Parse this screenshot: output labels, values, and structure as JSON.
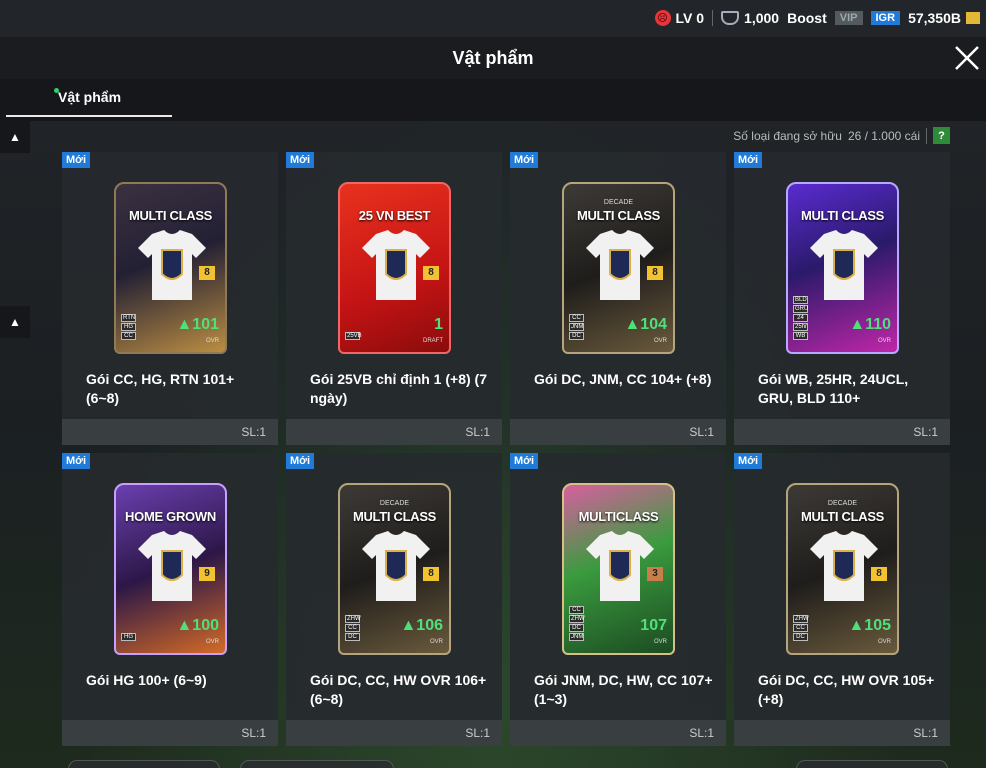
{
  "status": {
    "level": "LV 0",
    "coins": "1,000",
    "boost": "Boost",
    "vip": "VIP",
    "igr": "IGR",
    "bp": "57,350B"
  },
  "header": {
    "title": "Vật phẩm"
  },
  "tabs": [
    {
      "label": "Vật phẩm"
    }
  ],
  "inventory": {
    "count_label": "Số loại đang sở hữu",
    "count_value": "26 / 1.000 cái",
    "help": "?"
  },
  "items": [
    {
      "badge": "Mới",
      "name": "Gói CC, HG, RTN 101+ (6~8)",
      "qty": "SL:1",
      "card": {
        "style": "multi",
        "sub": "",
        "title": "MULTI CLASS",
        "level": "8",
        "ovr": "▲101",
        "ovr_label": "OVR",
        "positions": [
          "RTN",
          "HG",
          "CC"
        ]
      }
    },
    {
      "badge": "Mới",
      "name": "Gói 25VB chỉ định 1 (+8) (7 ngày)",
      "qty": "SL:1",
      "card": {
        "style": "red",
        "sub": "",
        "title": "25 VN BEST",
        "level": "8",
        "ovr": "1",
        "ovr_label": "DRAFT",
        "positions": [
          "25VB"
        ]
      }
    },
    {
      "badge": "Mới",
      "name": "Gói DC, JNM, CC 104+ (+8)",
      "qty": "SL:1",
      "card": {
        "style": "decade",
        "sub": "DECADE",
        "title": "MULTI CLASS",
        "level": "8",
        "ovr": "▲104",
        "ovr_label": "OVR",
        "positions": [
          "CC",
          "JNM",
          "DC"
        ]
      }
    },
    {
      "badge": "Mới",
      "name": "Gói WB, 25HR, 24UCL, GRU, BLD 110+",
      "qty": "SL:1",
      "card": {
        "style": "purple",
        "sub": "",
        "title": "MULTI CLASS",
        "level": "",
        "ovr": "▲110",
        "ovr_label": "OVR",
        "positions": [
          "BLD",
          "GRU",
          "24",
          "25hr",
          "WB"
        ]
      }
    },
    {
      "badge": "Mới",
      "name": "Gói HG 100+ (6~9)",
      "qty": "SL:1",
      "card": {
        "style": "hg",
        "sub": "",
        "title": "HOME GROWN",
        "level": "9",
        "ovr": "▲100",
        "ovr_label": "OVR",
        "positions": [
          "HG"
        ]
      }
    },
    {
      "badge": "Mới",
      "name": "Gói DC, CC, HW OVR 106+ (6~8)",
      "qty": "SL:1",
      "card": {
        "style": "decade",
        "sub": "DECADE",
        "title": "MULTI CLASS",
        "level": "8",
        "ovr": "▲106",
        "ovr_label": "OVR",
        "positions": [
          "ZHW",
          "CC",
          "DC"
        ]
      }
    },
    {
      "badge": "Mới",
      "name": "Gói JNM, DC, HW, CC 107+ (1~3)",
      "qty": "SL:1",
      "card": {
        "style": "green",
        "sub": "",
        "title": "MULTICLASS",
        "level": "3",
        "ovr": "107",
        "ovr_label": "OVR",
        "positions": [
          "CC",
          "ZHW",
          "DC",
          "JNM"
        ]
      }
    },
    {
      "badge": "Mới",
      "name": "Gói DC, CC, HW OVR 105+ (+8)",
      "qty": "SL:1",
      "card": {
        "style": "decade",
        "sub": "DECADE",
        "title": "MULTI CLASS",
        "level": "8",
        "ovr": "▲105",
        "ovr_label": "OVR",
        "positions": [
          "ZHW",
          "CC",
          "DC"
        ]
      }
    }
  ]
}
